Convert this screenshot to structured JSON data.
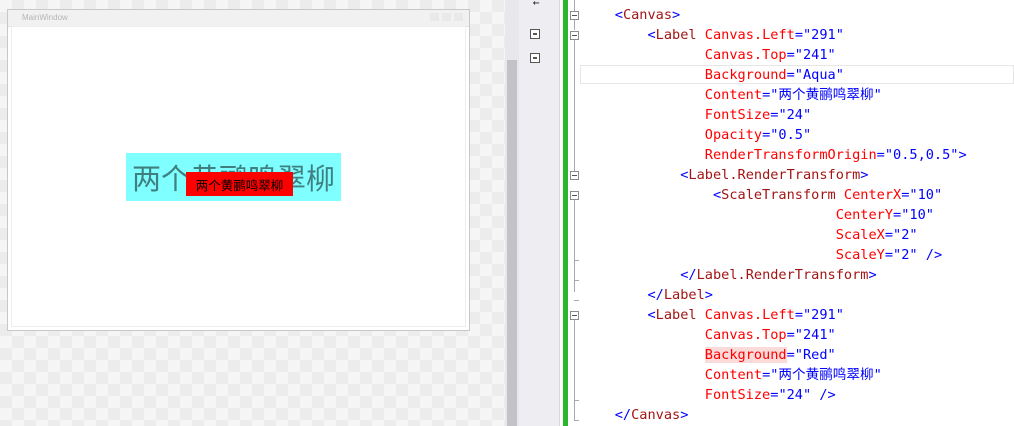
{
  "designer": {
    "window_title": "MainWindow",
    "aqua_label_text": "两个黄鹂鸣翠柳",
    "red_label_text": "两个黄鹂鸣翠柳"
  },
  "colors": {
    "aqua": "#00ffff",
    "red": "#ff0000",
    "splitter_green": "#2bb52b"
  },
  "tools": {
    "arrow": "←"
  },
  "code_lines": [
    {
      "indent": "    ",
      "parts": [
        {
          "t": "br",
          "v": "<"
        },
        {
          "t": "tag",
          "v": "Canvas"
        },
        {
          "t": "br",
          "v": ">"
        }
      ]
    },
    {
      "indent": "        ",
      "parts": [
        {
          "t": "br",
          "v": "<"
        },
        {
          "t": "tag",
          "v": "Label"
        },
        {
          "t": "sp",
          "v": " "
        },
        {
          "t": "attr",
          "v": "Canvas.Left"
        },
        {
          "t": "eq",
          "v": "="
        },
        {
          "t": "val",
          "v": "\"291\""
        }
      ]
    },
    {
      "indent": "               ",
      "parts": [
        {
          "t": "attr",
          "v": "Canvas.Top"
        },
        {
          "t": "eq",
          "v": "="
        },
        {
          "t": "val",
          "v": "\"241\""
        }
      ]
    },
    {
      "indent": "               ",
      "parts": [
        {
          "t": "attr",
          "v": "Background"
        },
        {
          "t": "eq",
          "v": "="
        },
        {
          "t": "val",
          "v": "\"Aqua\""
        }
      ]
    },
    {
      "indent": "               ",
      "parts": [
        {
          "t": "attr",
          "v": "Content"
        },
        {
          "t": "eq",
          "v": "="
        },
        {
          "t": "val",
          "v": "\"两个黄鹂鸣翠柳\""
        }
      ]
    },
    {
      "indent": "               ",
      "parts": [
        {
          "t": "attr",
          "v": "FontSize"
        },
        {
          "t": "eq",
          "v": "="
        },
        {
          "t": "val",
          "v": "\"24\""
        }
      ]
    },
    {
      "indent": "               ",
      "parts": [
        {
          "t": "attr",
          "v": "Opacity"
        },
        {
          "t": "eq",
          "v": "="
        },
        {
          "t": "val",
          "v": "\"0.5\""
        }
      ]
    },
    {
      "indent": "               ",
      "parts": [
        {
          "t": "attr",
          "v": "RenderTransformOrigin"
        },
        {
          "t": "eq",
          "v": "="
        },
        {
          "t": "val",
          "v": "\"0.5,0.5\""
        },
        {
          "t": "br",
          "v": ">"
        }
      ]
    },
    {
      "indent": "            ",
      "parts": [
        {
          "t": "br",
          "v": "<"
        },
        {
          "t": "tag",
          "v": "Label.RenderTransform"
        },
        {
          "t": "br",
          "v": ">"
        }
      ]
    },
    {
      "indent": "                ",
      "parts": [
        {
          "t": "br",
          "v": "<"
        },
        {
          "t": "tag",
          "v": "ScaleTransform"
        },
        {
          "t": "sp",
          "v": " "
        },
        {
          "t": "attr",
          "v": "CenterX"
        },
        {
          "t": "eq",
          "v": "="
        },
        {
          "t": "val",
          "v": "\"10\""
        }
      ]
    },
    {
      "indent": "                               ",
      "parts": [
        {
          "t": "attr",
          "v": "CenterY"
        },
        {
          "t": "eq",
          "v": "="
        },
        {
          "t": "val",
          "v": "\"10\""
        }
      ]
    },
    {
      "indent": "                               ",
      "parts": [
        {
          "t": "attr",
          "v": "ScaleX"
        },
        {
          "t": "eq",
          "v": "="
        },
        {
          "t": "val",
          "v": "\"2\""
        }
      ]
    },
    {
      "indent": "                               ",
      "parts": [
        {
          "t": "attr",
          "v": "ScaleY"
        },
        {
          "t": "eq",
          "v": "="
        },
        {
          "t": "val",
          "v": "\"2\""
        },
        {
          "t": "sp",
          "v": " "
        },
        {
          "t": "br",
          "v": "/>"
        }
      ]
    },
    {
      "indent": "            ",
      "parts": [
        {
          "t": "br",
          "v": "</"
        },
        {
          "t": "tag",
          "v": "Label.RenderTransform"
        },
        {
          "t": "br",
          "v": ">"
        }
      ]
    },
    {
      "indent": "        ",
      "parts": [
        {
          "t": "br",
          "v": "</"
        },
        {
          "t": "tag",
          "v": "Label"
        },
        {
          "t": "br",
          "v": ">"
        }
      ]
    },
    {
      "indent": "        ",
      "parts": [
        {
          "t": "br",
          "v": "<"
        },
        {
          "t": "tag",
          "v": "Label"
        },
        {
          "t": "sp",
          "v": " "
        },
        {
          "t": "attr",
          "v": "Canvas.Left"
        },
        {
          "t": "eq",
          "v": "="
        },
        {
          "t": "val",
          "v": "\"291\""
        }
      ]
    },
    {
      "indent": "               ",
      "parts": [
        {
          "t": "attr",
          "v": "Canvas.Top"
        },
        {
          "t": "eq",
          "v": "="
        },
        {
          "t": "val",
          "v": "\"241\""
        }
      ]
    },
    {
      "indent": "               ",
      "parts": [
        {
          "t": "attrhl",
          "v": "Background"
        },
        {
          "t": "eq",
          "v": "="
        },
        {
          "t": "val",
          "v": "\"Red\""
        }
      ]
    },
    {
      "indent": "               ",
      "parts": [
        {
          "t": "attr",
          "v": "Content"
        },
        {
          "t": "eq",
          "v": "="
        },
        {
          "t": "val",
          "v": "\"两个黄鹂鸣翠柳\""
        }
      ]
    },
    {
      "indent": "               ",
      "parts": [
        {
          "t": "attr",
          "v": "FontSize"
        },
        {
          "t": "eq",
          "v": "="
        },
        {
          "t": "val",
          "v": "\"24\""
        },
        {
          "t": "sp",
          "v": " "
        },
        {
          "t": "br",
          "v": "/>"
        }
      ]
    },
    {
      "indent": "    ",
      "parts": [
        {
          "t": "br",
          "v": "</"
        },
        {
          "t": "tag",
          "v": "Canvas"
        },
        {
          "t": "br",
          "v": ">"
        }
      ]
    }
  ]
}
